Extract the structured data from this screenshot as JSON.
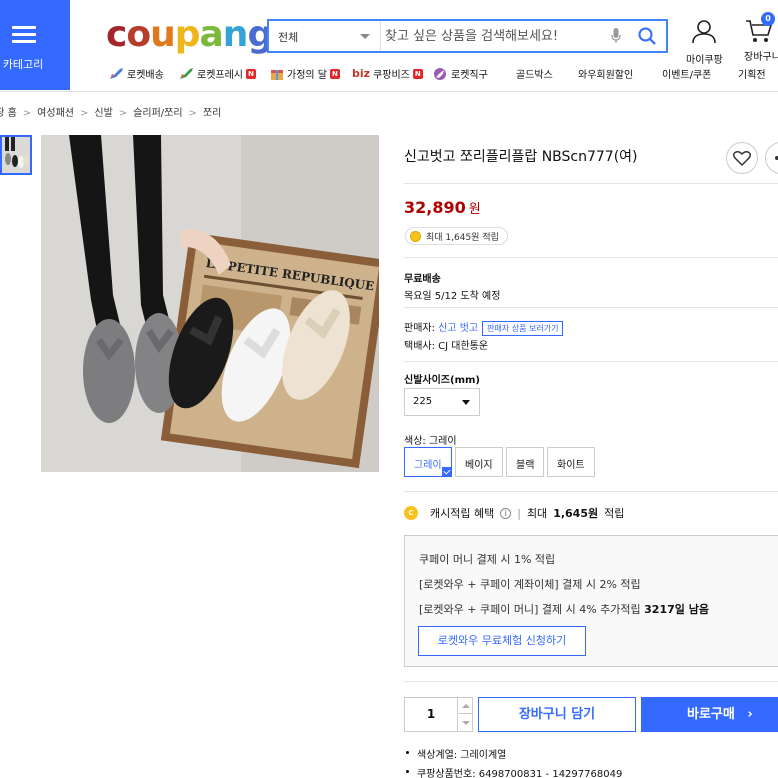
{
  "header": {
    "category_label": "카테고리",
    "logo_text": "coupang",
    "logo_colors": [
      "#a3262f",
      "#b83c2b",
      "#e0781e",
      "#f1b51c",
      "#7bb93d",
      "#35a3d9",
      "#4b6bd1"
    ],
    "search_scope": "전체",
    "search_placeholder": "찾고 싶은 상품을 검색해보세요!",
    "mypage_label": "마이쿠팡",
    "cart_label": "장바구니",
    "cart_count": "0"
  },
  "nav": {
    "items": [
      "로켓배송",
      "로켓프레시",
      "가정의 달",
      "쿠팡비즈",
      "로켓직구",
      "골드박스",
      "와우회원할인",
      "이벤트/쿠폰",
      "기획전"
    ],
    "biz_prefix": "biz",
    "new_badge": "N"
  },
  "breadcrumb": [
    "쿠팡 홈",
    "여성패션",
    "신발",
    "슬리퍼/쪼리",
    "쪼리"
  ],
  "product": {
    "title": "신고벗고 쪼리플리플랍 NBScn777(여)",
    "price": "32,890",
    "price_unit": "원",
    "reward_text": "최대 1,645원 적립",
    "shipping_label": "무료배송",
    "delivery_text": "목요일 5/12 도착 예정",
    "seller_label": "판매자:",
    "seller_name": "신고 벗고",
    "seller_btn": "판매자 상품 보러가기",
    "courier_text": "택배사: CJ 대한통운",
    "size_label": "신발사이즈(mm)",
    "size_value": "225",
    "color_label": "색상: 그레이",
    "colors": [
      "그레이",
      "베이지",
      "블랙",
      "화이트"
    ],
    "cash_label": "캐시적립 혜택",
    "cash_info": "i",
    "cash_prefix": "최대",
    "cash_amount": "1,645원",
    "cash_suffix": "적립"
  },
  "benefits": {
    "line1": "쿠페이 머니 결제 시 1% 적립",
    "line2": "[로켓와우 + 쿠페이 계좌이체] 결제 시 2% 적립",
    "line3_prefix": "[로켓와우 + 쿠페이 머니] 결제 시 4% 추가적립",
    "line3_days": "3217일 남음",
    "cta": "로켓와우 무료체험 신청하기"
  },
  "purchase": {
    "quantity": "1",
    "cart_button": "장바구니 담기",
    "buy_button": "바로구매"
  },
  "details": {
    "color_group": "색상계열: 그레이계열",
    "product_no": "쿠팡상품번호: 6498700831 - 14297768049"
  },
  "image": {
    "sign_text": "LA PETITE REPUBLIQUE"
  }
}
